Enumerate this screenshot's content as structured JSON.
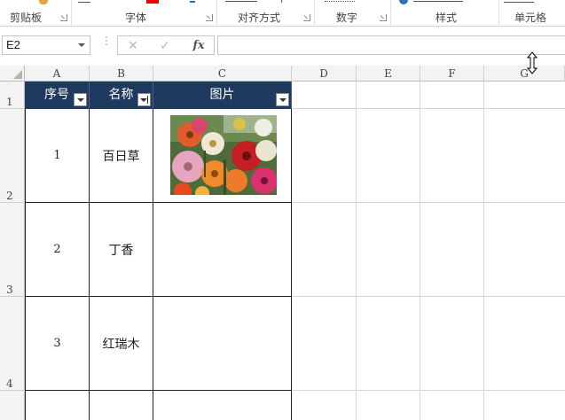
{
  "ribbon": {
    "groups": [
      {
        "label": "剪贴板"
      },
      {
        "label": "字体"
      },
      {
        "label": "对齐方式"
      },
      {
        "label": "数字"
      },
      {
        "label": "样式"
      },
      {
        "label": "单元格"
      }
    ]
  },
  "formula_bar": {
    "name_box": "E2",
    "cancel_icon": "✕",
    "enter_icon": "✓",
    "fx_label": "fx",
    "formula_value": ""
  },
  "grid": {
    "columns": [
      "A",
      "B",
      "C",
      "D",
      "E",
      "F",
      "G"
    ],
    "rows": [
      "1",
      "2",
      "3",
      "4"
    ]
  },
  "table": {
    "headers": [
      "序号",
      "名称",
      "图片"
    ],
    "rows": [
      {
        "num": "1",
        "name": "百日草",
        "has_picture": true
      },
      {
        "num": "2",
        "name": "丁香",
        "has_picture": false
      },
      {
        "num": "3",
        "name": "红瑞木",
        "has_picture": false
      }
    ]
  },
  "colors": {
    "header_fill": "#1f3a5f",
    "header_text": "#ffffff",
    "grid_line": "#d4d4d4"
  },
  "icons": {
    "name_box_dropdown": "chevron-down-icon",
    "filter": "filter-dropdown-icon",
    "sort": "sort-icon",
    "cursor": "resize-vertical-cursor-icon"
  }
}
